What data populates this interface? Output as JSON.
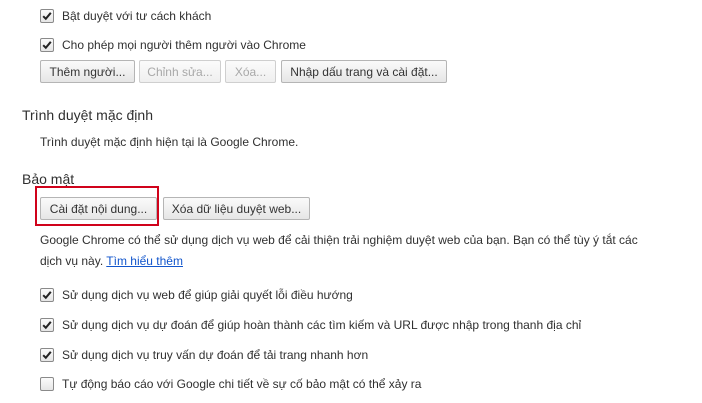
{
  "people": {
    "guest_browsing_label": "Bật duyệt với tư cách khách",
    "guest_browsing_checked": true,
    "anyone_add_person_label": "Cho phép mọi người thêm người vào Chrome",
    "anyone_add_person_checked": true,
    "buttons": {
      "add_person": "Thêm người...",
      "edit": "Chỉnh sửa...",
      "remove": "Xóa...",
      "import": "Nhập dấu trang và cài đặt..."
    }
  },
  "default_browser": {
    "title": "Trình duyệt mặc định",
    "status": "Trình duyệt mặc định hiện tại là Google Chrome."
  },
  "privacy": {
    "title": "Bảo mật",
    "content_settings_button": "Cài đặt nội dung...",
    "clear_data_button": "Xóa dữ liệu duyệt web...",
    "description_line1": "Google Chrome có thể sử dụng dịch vụ web để cải thiện trải nghiệm duyệt web của bạn. Bạn có thể tùy ý tắt các",
    "description_line2": "dịch vụ này.",
    "learn_more": "Tìm hiểu thêm",
    "options": [
      {
        "label": "Sử dụng dịch vụ web để giúp giải quyết lỗi điều hướng",
        "checked": true
      },
      {
        "label": "Sử dụng dịch vụ dự đoán để giúp hoàn thành các tìm kiếm và URL được nhập trong thanh địa chỉ",
        "checked": true
      },
      {
        "label": "Sử dụng dịch vụ truy vấn dự đoán để tải trang nhanh hơn",
        "checked": true
      },
      {
        "label": "Tự động báo cáo với Google chi tiết về sự cố bảo mật có thể xảy ra",
        "checked": false
      }
    ]
  }
}
